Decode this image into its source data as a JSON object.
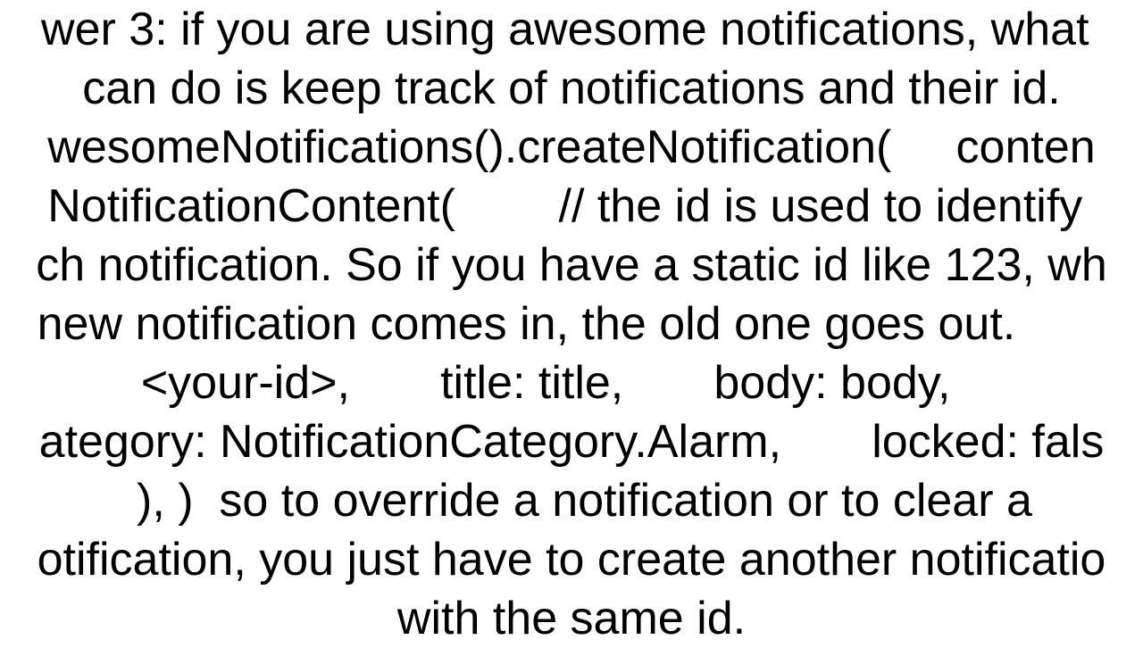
{
  "content": {
    "text": "wer 3: if you are using awesome notifications, what \ncan do is keep track of notifications and their id.\nwesomeNotifications().createNotification(     conten\nNotificationContent(        // the id is used to identify \nch notification. So if you have a static id like 123, wh\nnew notification comes in, the old one goes out.       \n  <your-id>,       title: title,       body: body,      \nategory: NotificationCategory.Alarm,       locked: fals\n  ), )  so to override a notification or to clear a\notification, you just have to create another notificatio\nwith the same id."
  }
}
